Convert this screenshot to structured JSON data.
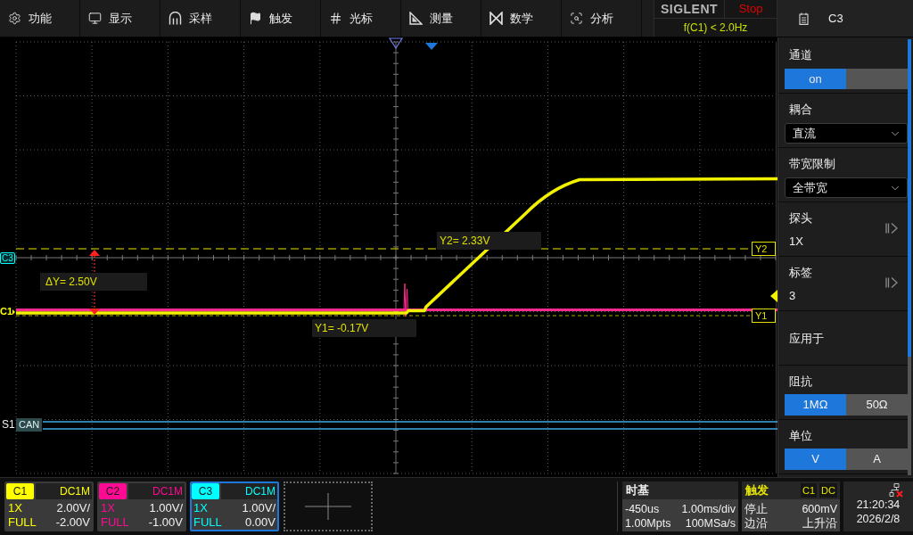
{
  "menu": [
    "功能",
    "显示",
    "采样",
    "触发",
    "光标",
    "测量",
    "数学",
    "分析"
  ],
  "status": {
    "brand": "SIGLENT",
    "run_state": "Stop",
    "frequency": "f(C1) < 2.0Hz"
  },
  "display": {
    "markers": [
      {
        "label": "C3",
        "color": "#00ffff",
        "selected": true
      },
      {
        "label": "C1",
        "color": "#ffff00",
        "selected": false
      }
    ],
    "cursors": [
      {
        "label": "Y2",
        "readout": "Y2= 2.33V"
      },
      {
        "label": "Y1",
        "readout": "Y1= -0.17V"
      }
    ],
    "delta": "ΔY= 2.50V",
    "bus": {
      "name": "S1",
      "protocol": "CAN"
    }
  },
  "panel": {
    "title": "C3",
    "items": [
      {
        "kind": "toggle",
        "label": "通道",
        "on": true,
        "state_label": "on"
      },
      {
        "kind": "dropdown",
        "label": "耦合",
        "value": "直流"
      },
      {
        "kind": "dropdown",
        "label": "带宽限制",
        "value": "全带宽"
      },
      {
        "kind": "link",
        "label": "探头",
        "value": "1X"
      },
      {
        "kind": "link",
        "label": "标签",
        "value": "3"
      },
      {
        "kind": "plain",
        "label": "应用于"
      },
      {
        "kind": "segmented",
        "label": "阻抗",
        "options": [
          {
            "label": "1MΩ",
            "selected": true
          },
          {
            "label": "50Ω",
            "selected": false
          }
        ]
      },
      {
        "kind": "segmented",
        "label": "单位",
        "options": [
          {
            "label": "V",
            "selected": true
          },
          {
            "label": "A",
            "selected": false
          }
        ]
      }
    ]
  },
  "channels": [
    {
      "name": "C1",
      "coupling": "DC1M",
      "probe": "1X",
      "scale": "2.00V/",
      "bandwidth": "FULL",
      "offset": "-2.00V",
      "color": "#ffff00",
      "selected": false
    },
    {
      "name": "C2",
      "coupling": "DC1M",
      "probe": "1X",
      "scale": "1.00V/",
      "bandwidth": "FULL",
      "offset": "-1.00V",
      "color": "#ff0a93",
      "selected": false
    },
    {
      "name": "C3",
      "coupling": "DC1M",
      "probe": "1X",
      "scale": "1.00V/",
      "bandwidth": "FULL",
      "offset": "0.00V",
      "color": "#00ffff",
      "selected": true
    }
  ],
  "timebase": {
    "title": "时基",
    "delay": "-450us",
    "scale": "1.00ms/div",
    "memory": "1.00Mpts",
    "sample_rate": "100MSa/s"
  },
  "trigger": {
    "title": "触发",
    "source": "C1",
    "coupling": "DC",
    "state": "停止",
    "level": "600mV",
    "type": "边沿",
    "slope": "上升沿"
  },
  "clock": {
    "time": "21:20:34",
    "date": "2026/2/8"
  }
}
